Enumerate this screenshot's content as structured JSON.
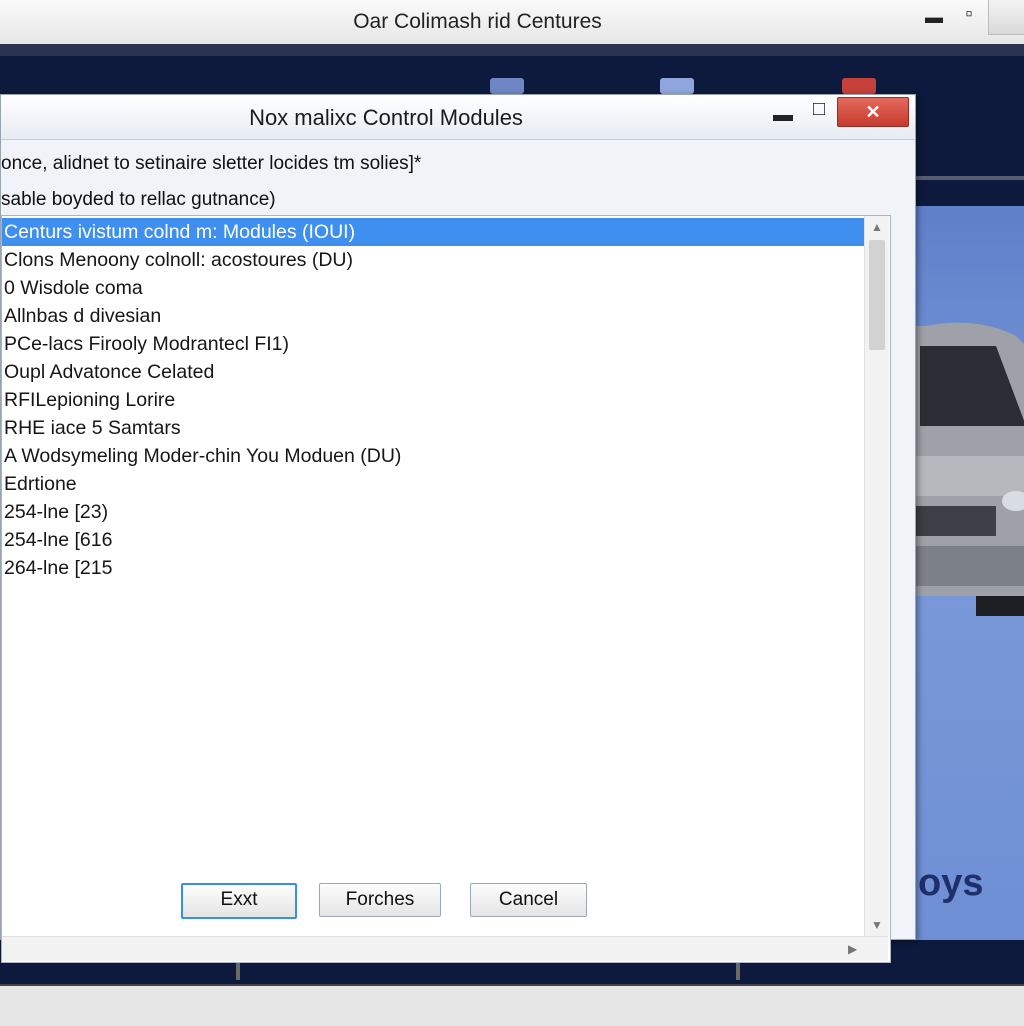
{
  "outer_window": {
    "title": "Oar Colimash rid Centures"
  },
  "dialog": {
    "title": "Nox malixc Control Modules",
    "close_label": "✕",
    "instruction_line1": "once, alidnet to setinaire sletter locides tm solies]*",
    "instruction_line2": "sable boyded to rellac gutnance)",
    "list_items": [
      "Centurs ivistum colnd m: Modules (IOUI)",
      "Clons Menoony colnoll: acostoures (DU)",
      "0 Wisdole coma",
      "Allnbas d divesian",
      "PCe-lacs Firooly Modrantecl FI1)",
      "Oupl Advatonce Celated",
      "RFILepioning Lorire",
      "RHE iace 5 Samtars",
      "A Wodsymeling Moder-chin You Moduen (DU)",
      "Edrtione",
      "254-lne [23)",
      "254-lne [616",
      "264-lne [215"
    ],
    "selected_index": 0,
    "buttons": {
      "exit": "Exxt",
      "forches": "Forches",
      "cancel": "Cancel"
    }
  },
  "side_panel": {
    "brand_text": "oys"
  },
  "colors": {
    "selection": "#3f8ff0",
    "close_button": "#c63a2d",
    "app_background": "#0d1a3d"
  }
}
